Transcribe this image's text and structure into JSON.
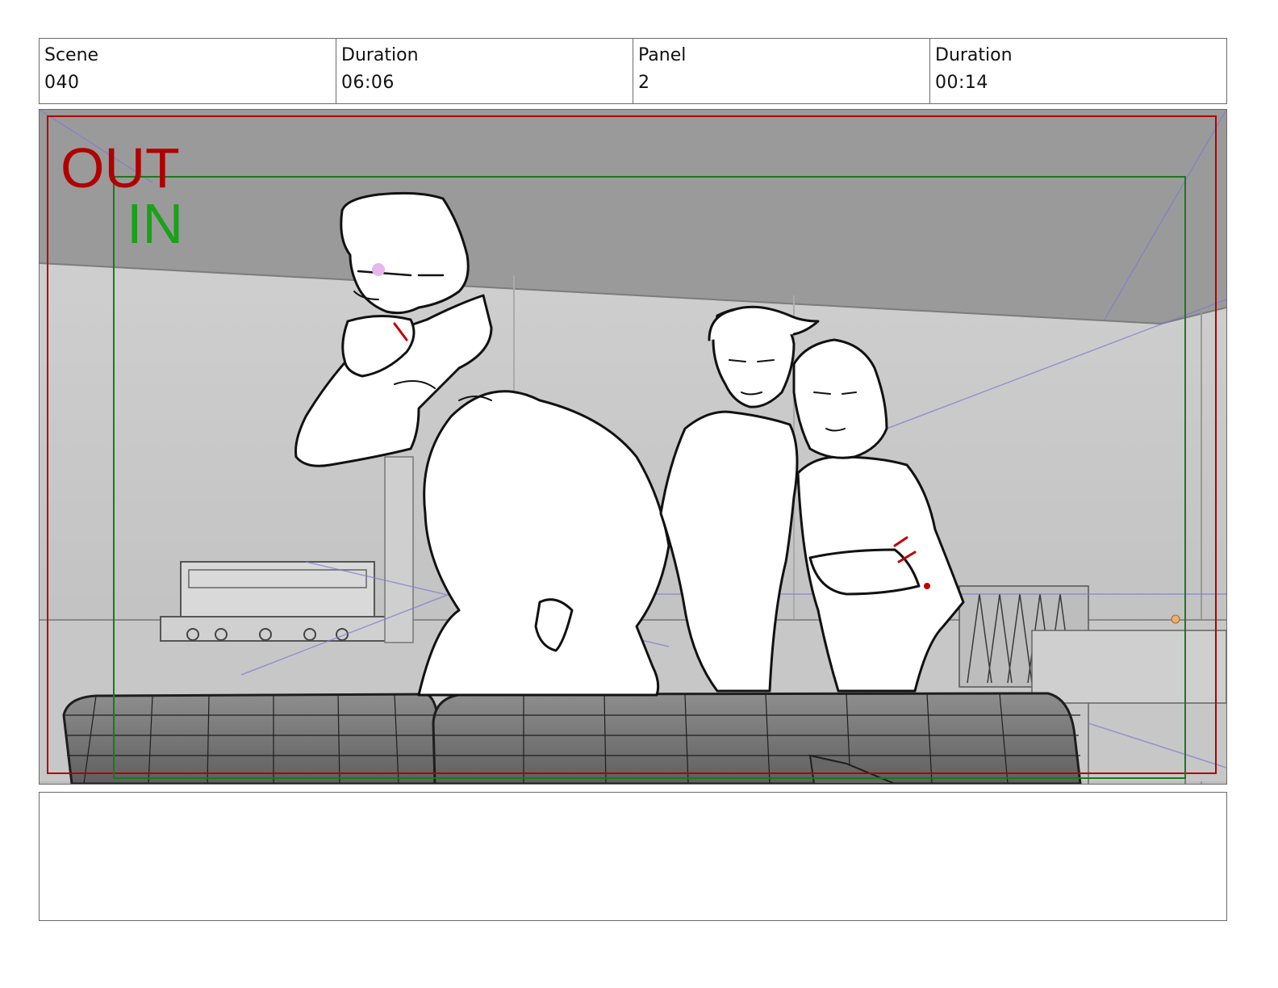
{
  "header": {
    "scene_label": "Scene",
    "scene_value": "040",
    "duration_label": "Duration",
    "duration_value": "06:06",
    "panel_label": "Panel",
    "panel_value": "2",
    "panel_duration_label": "Duration",
    "panel_duration_value": "00:14"
  },
  "frame": {
    "out_label": "OUT",
    "in_label": "IN",
    "out_color": "#b00000",
    "in_color": "#1aa11a"
  },
  "notes": {
    "text": ""
  }
}
